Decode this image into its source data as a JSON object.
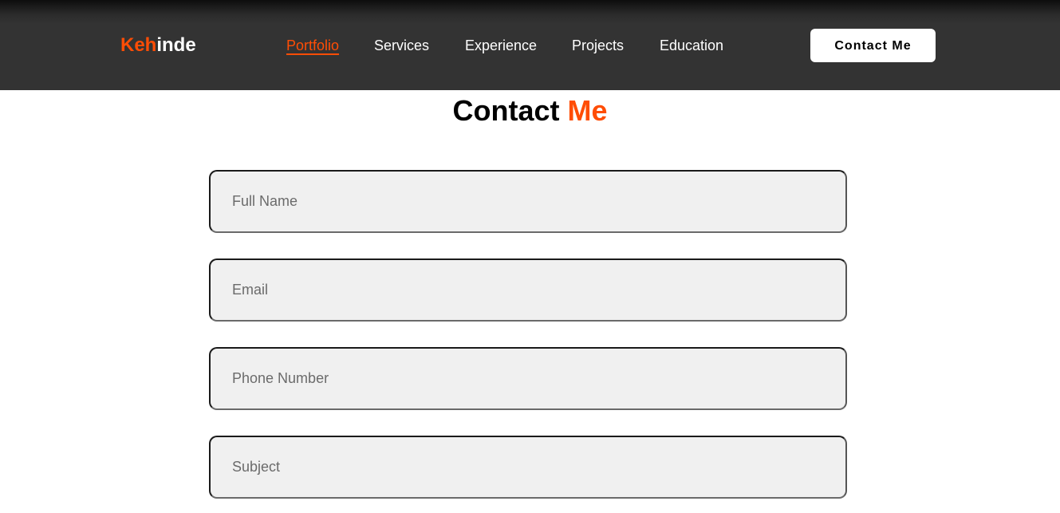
{
  "brand": {
    "logo_accent": "Keh",
    "logo_rest": "inde",
    "accent_color": "#ff4d05"
  },
  "nav": {
    "links": [
      {
        "label": "Portfolio",
        "active": true
      },
      {
        "label": "Services",
        "active": false
      },
      {
        "label": "Experience",
        "active": false
      },
      {
        "label": "Projects",
        "active": false
      },
      {
        "label": "Education",
        "active": false
      }
    ],
    "cta_label": "Contact Me"
  },
  "contact": {
    "title_main": "Contact",
    "title_accent": "Me",
    "fields": {
      "full_name": {
        "placeholder": "Full Name",
        "value": ""
      },
      "email": {
        "placeholder": "Email",
        "value": ""
      },
      "phone": {
        "placeholder": "Phone Number",
        "value": ""
      },
      "subject": {
        "placeholder": "Subject",
        "value": ""
      }
    }
  }
}
